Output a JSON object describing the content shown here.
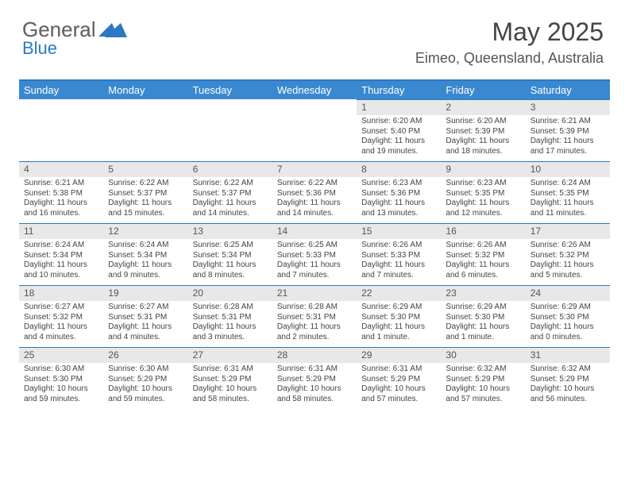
{
  "brand": {
    "word1": "General",
    "word2": "Blue"
  },
  "header": {
    "title": "May 2025",
    "location": "Eimeo, Queensland, Australia"
  },
  "daysOfWeek": [
    "Sunday",
    "Monday",
    "Tuesday",
    "Wednesday",
    "Thursday",
    "Friday",
    "Saturday"
  ],
  "startOffset": 4,
  "cells": [
    {
      "n": 1,
      "sr": "6:20 AM",
      "ss": "5:40 PM",
      "dl": "11 hours and 19 minutes."
    },
    {
      "n": 2,
      "sr": "6:20 AM",
      "ss": "5:39 PM",
      "dl": "11 hours and 18 minutes."
    },
    {
      "n": 3,
      "sr": "6:21 AM",
      "ss": "5:39 PM",
      "dl": "11 hours and 17 minutes."
    },
    {
      "n": 4,
      "sr": "6:21 AM",
      "ss": "5:38 PM",
      "dl": "11 hours and 16 minutes."
    },
    {
      "n": 5,
      "sr": "6:22 AM",
      "ss": "5:37 PM",
      "dl": "11 hours and 15 minutes."
    },
    {
      "n": 6,
      "sr": "6:22 AM",
      "ss": "5:37 PM",
      "dl": "11 hours and 14 minutes."
    },
    {
      "n": 7,
      "sr": "6:22 AM",
      "ss": "5:36 PM",
      "dl": "11 hours and 14 minutes."
    },
    {
      "n": 8,
      "sr": "6:23 AM",
      "ss": "5:36 PM",
      "dl": "11 hours and 13 minutes."
    },
    {
      "n": 9,
      "sr": "6:23 AM",
      "ss": "5:35 PM",
      "dl": "11 hours and 12 minutes."
    },
    {
      "n": 10,
      "sr": "6:24 AM",
      "ss": "5:35 PM",
      "dl": "11 hours and 11 minutes."
    },
    {
      "n": 11,
      "sr": "6:24 AM",
      "ss": "5:34 PM",
      "dl": "11 hours and 10 minutes."
    },
    {
      "n": 12,
      "sr": "6:24 AM",
      "ss": "5:34 PM",
      "dl": "11 hours and 9 minutes."
    },
    {
      "n": 13,
      "sr": "6:25 AM",
      "ss": "5:34 PM",
      "dl": "11 hours and 8 minutes."
    },
    {
      "n": 14,
      "sr": "6:25 AM",
      "ss": "5:33 PM",
      "dl": "11 hours and 7 minutes."
    },
    {
      "n": 15,
      "sr": "6:26 AM",
      "ss": "5:33 PM",
      "dl": "11 hours and 7 minutes."
    },
    {
      "n": 16,
      "sr": "6:26 AM",
      "ss": "5:32 PM",
      "dl": "11 hours and 6 minutes."
    },
    {
      "n": 17,
      "sr": "6:26 AM",
      "ss": "5:32 PM",
      "dl": "11 hours and 5 minutes."
    },
    {
      "n": 18,
      "sr": "6:27 AM",
      "ss": "5:32 PM",
      "dl": "11 hours and 4 minutes."
    },
    {
      "n": 19,
      "sr": "6:27 AM",
      "ss": "5:31 PM",
      "dl": "11 hours and 4 minutes."
    },
    {
      "n": 20,
      "sr": "6:28 AM",
      "ss": "5:31 PM",
      "dl": "11 hours and 3 minutes."
    },
    {
      "n": 21,
      "sr": "6:28 AM",
      "ss": "5:31 PM",
      "dl": "11 hours and 2 minutes."
    },
    {
      "n": 22,
      "sr": "6:29 AM",
      "ss": "5:30 PM",
      "dl": "11 hours and 1 minute."
    },
    {
      "n": 23,
      "sr": "6:29 AM",
      "ss": "5:30 PM",
      "dl": "11 hours and 1 minute."
    },
    {
      "n": 24,
      "sr": "6:29 AM",
      "ss": "5:30 PM",
      "dl": "11 hours and 0 minutes."
    },
    {
      "n": 25,
      "sr": "6:30 AM",
      "ss": "5:30 PM",
      "dl": "10 hours and 59 minutes."
    },
    {
      "n": 26,
      "sr": "6:30 AM",
      "ss": "5:29 PM",
      "dl": "10 hours and 59 minutes."
    },
    {
      "n": 27,
      "sr": "6:31 AM",
      "ss": "5:29 PM",
      "dl": "10 hours and 58 minutes."
    },
    {
      "n": 28,
      "sr": "6:31 AM",
      "ss": "5:29 PM",
      "dl": "10 hours and 58 minutes."
    },
    {
      "n": 29,
      "sr": "6:31 AM",
      "ss": "5:29 PM",
      "dl": "10 hours and 57 minutes."
    },
    {
      "n": 30,
      "sr": "6:32 AM",
      "ss": "5:29 PM",
      "dl": "10 hours and 57 minutes."
    },
    {
      "n": 31,
      "sr": "6:32 AM",
      "ss": "5:29 PM",
      "dl": "10 hours and 56 minutes."
    }
  ],
  "labels": {
    "sunrise": "Sunrise:",
    "sunset": "Sunset:",
    "daylight": "Daylight:"
  }
}
